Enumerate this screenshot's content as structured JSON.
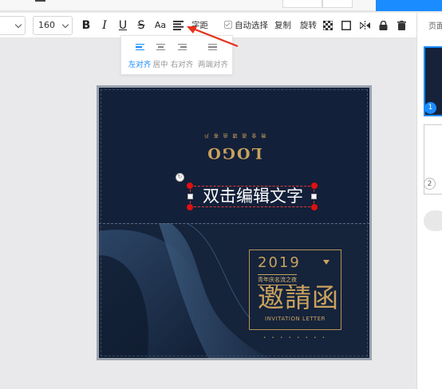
{
  "toolbar": {
    "font_size": "160",
    "bold": "B",
    "italic": "I",
    "underline": "U",
    "strike": "S",
    "case": "Aa",
    "spacing_label": "字距",
    "auto_select_label": "自动选择",
    "copy_label": "复制",
    "rotate_label": "旋转"
  },
  "align_popup": {
    "options": [
      {
        "label": "左对齐",
        "active": true
      },
      {
        "label": "居中",
        "active": false
      },
      {
        "label": "右对齐",
        "active": false
      },
      {
        "label": "两端对齐",
        "active": false
      }
    ]
  },
  "canvas": {
    "edit_text": "双击编辑文字",
    "logo": "LOGO",
    "logo_small": "晚 會 邀 請 函 客 戶",
    "year": "2019",
    "subtitle": "青年庆名流之夜",
    "big_title": "邀請函",
    "invitation": "INVITATION LETTER",
    "dots": "• • • •   • • • •"
  },
  "right_panel": {
    "header": "页面",
    "pages": [
      "1",
      "2"
    ]
  },
  "colors": {
    "accent": "#1a8cff",
    "gold": "#c9a25e",
    "selection": "#e01010",
    "design_bg": "#14213a"
  }
}
